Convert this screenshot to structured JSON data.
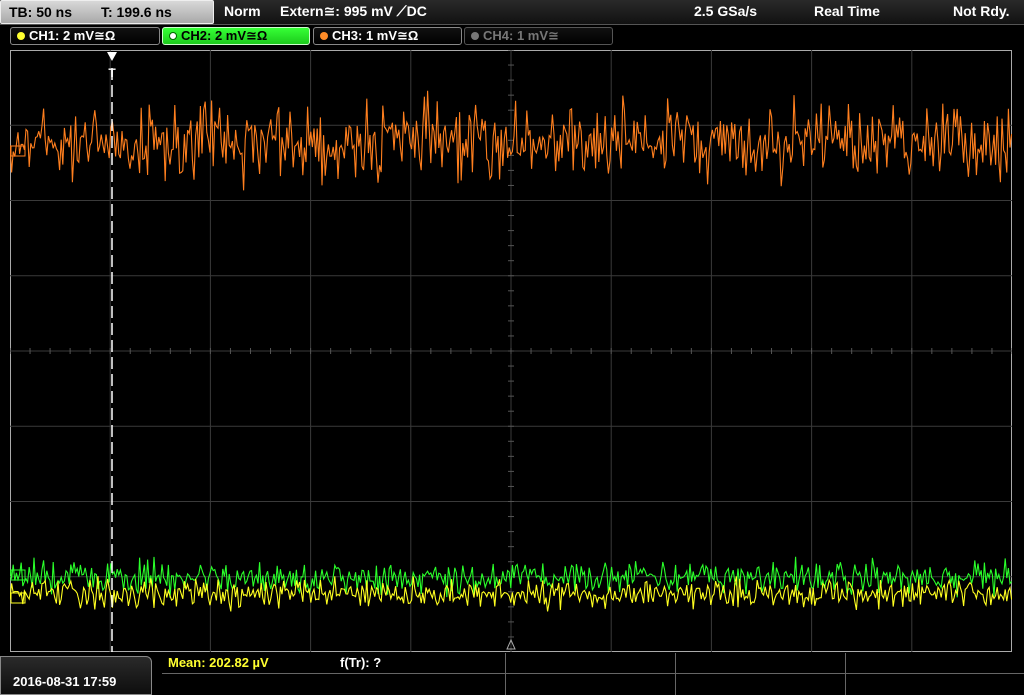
{
  "status_bar": {
    "timebase": "TB: 50 ns",
    "trigger_time": "T: 199.6 ns",
    "mode": "Norm",
    "trigger_source": "Extern≅: 995 mV ⟋DC",
    "sample_rate": "2.5 GSa/s",
    "acquisition": "Real Time",
    "state": "Not Rdy."
  },
  "channels": [
    {
      "label": "CH1: 2 mV≅Ω",
      "color": "#ffff30",
      "active": false,
      "enabled": true
    },
    {
      "label": "CH2: 2 mV≅Ω",
      "color": "#30ff30",
      "active": true,
      "enabled": true
    },
    {
      "label": "CH3: 1 mV≅Ω",
      "color": "#ff8c28",
      "active": false,
      "enabled": true
    },
    {
      "label": "CH4: 1 mV≅",
      "color": "#777777",
      "active": false,
      "enabled": false
    }
  ],
  "trigger_marker": "T",
  "measurements": {
    "mean": "Mean: 202.82 µV",
    "freq": "f(Tr): ?"
  },
  "datetime": "2016-08-31 17:59",
  "traces": {
    "ch3_color": "#ff7f1e",
    "ch2_color": "#2aff2a",
    "ch1_color": "#ffff20"
  }
}
